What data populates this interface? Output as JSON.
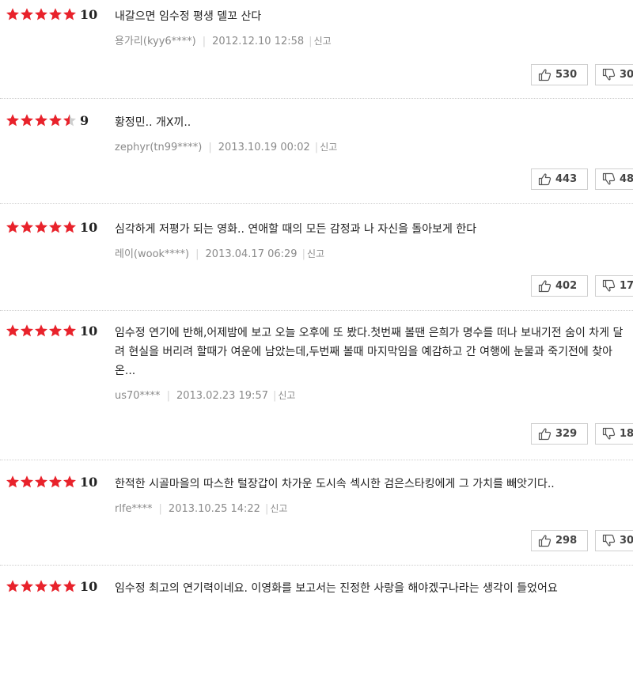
{
  "colors": {
    "star_on": "#e8222b",
    "star_off": "#cfcfcf"
  },
  "icons": {
    "like": "thumbs-up-icon",
    "dislike": "thumbs-down-icon"
  },
  "reviews": [
    {
      "rating": 5,
      "score": "10",
      "content": "내갈으면 임수정 평생 델꼬 산다",
      "author": "용가리(kyy6****)",
      "date": "2012.12.10 12:58",
      "report": "신고",
      "likes": "530",
      "dislikes": "30"
    },
    {
      "rating": 4.5,
      "score": "9",
      "content": "황정민.. 개X끼..",
      "author": "zephyr(tn99****)",
      "date": "2013.10.19 00:02",
      "report": "신고",
      "likes": "443",
      "dislikes": "48"
    },
    {
      "rating": 5,
      "score": "10",
      "content": "심각하게 저평가 되는 영화.. 연애할 때의 모든 감정과 나 자신을 돌아보게 한다",
      "author": "레이(wook****)",
      "date": "2013.04.17 06:29",
      "report": "신고",
      "likes": "402",
      "dislikes": "17"
    },
    {
      "rating": 5,
      "score": "10",
      "content": "임수정 연기에 반해,어제밤에 보고 오늘 오후에 또 봤다.첫번째 볼땐 은희가 명수를 떠나 보내기전 숨이 차게 달려 현실을 버리려 할때가 여운에 남았는데,두번째 볼때 마지막임을 예감하고 간 여행에 눈물과 죽기전에 찾아온...",
      "author": "us70****",
      "date": "2013.02.23 19:57",
      "report": "신고",
      "likes": "329",
      "dislikes": "18"
    },
    {
      "rating": 5,
      "score": "10",
      "content": "한적한 시골마을의 따스한 털장갑이 차가운 도시속 섹시한 검은스타킹에게 그 가치를 빼앗기다..",
      "author": "rlfe****",
      "date": "2013.10.25 14:22",
      "report": "신고",
      "likes": "298",
      "dislikes": "30"
    },
    {
      "rating": 5,
      "score": "10",
      "content": "임수정 최고의 연기력이네요. 이영화를 보고서는 진정한 사랑을 해야겠구나라는 생각이 들었어요",
      "author": "",
      "date": "",
      "report": "",
      "likes": "",
      "dislikes": ""
    }
  ]
}
